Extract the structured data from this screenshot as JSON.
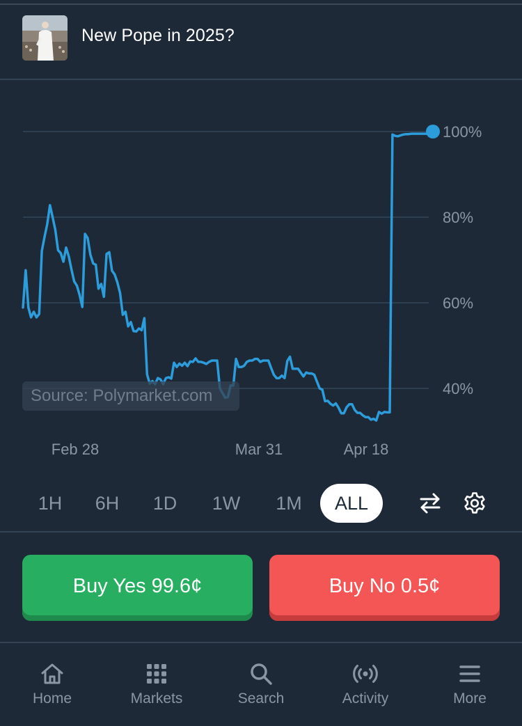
{
  "market": {
    "title": "New Pope in 2025?",
    "thumbnail": "pope-photo"
  },
  "chart_data": {
    "type": "line",
    "title": "",
    "xlabel": "",
    "ylabel": "",
    "ylim": [
      0,
      100
    ],
    "y_gridlines": [
      40,
      60,
      80,
      100
    ],
    "y_tick_labels": [
      "40%",
      "60%",
      "80%",
      "100%"
    ],
    "x_tick_labels": [
      "Feb 28",
      "Mar 31",
      "Apr 18"
    ],
    "grid": true,
    "color": "#2d9cdb",
    "watermark": "Source: Polymarket.com",
    "series": [
      {
        "values": [
          58.9,
          67.6,
          58.9,
          56.6,
          57.9,
          56.6,
          57.4,
          72.1,
          75.4,
          78.4,
          82.8,
          80.0,
          77.0,
          72.3,
          71.6,
          69.6,
          72.9,
          70.8,
          67.7,
          65.0,
          64.0,
          61.8,
          59.0,
          76.1,
          75.1,
          71.2,
          69.2,
          68.9,
          63.3,
          64.4,
          61.4,
          71.4,
          71.8,
          67.5,
          66.6,
          64.8,
          62.3,
          57.2,
          57.9,
          54.5,
          55.5,
          53.4,
          53.3,
          54.0,
          53.6,
          56.4,
          43.3,
          41.1,
          41.7,
          41.0,
          42.4,
          42.1,
          41.0,
          42.4,
          42.6,
          42.3,
          46.0,
          45.0,
          45.8,
          45.3,
          46.0,
          45.2,
          46.3,
          46.2,
          47.0,
          46.2,
          46.2,
          46.0,
          45.7,
          46.2,
          46.5,
          46.5,
          46.5,
          40.0,
          38.9,
          37.8,
          38.0,
          40.7,
          40.7,
          46.9,
          45.0,
          45.0,
          45.3,
          46.2,
          46.5,
          46.5,
          46.9,
          46.9,
          46.2,
          46.5,
          46.5,
          46.5,
          44.8,
          43.2,
          42.4,
          42.4,
          43.0,
          42.4,
          46.4,
          47.4,
          44.6,
          44.6,
          44.6,
          43.7,
          42.8,
          43.7,
          43.5,
          43.5,
          43.2,
          41.6,
          40.0,
          39.7,
          37.0,
          37.1,
          36.4,
          36.0,
          36.5,
          35.5,
          34.2,
          34.2,
          35.6,
          36.3,
          36.3,
          35.0,
          34.3,
          34.3,
          33.7,
          33.3,
          33.3,
          32.7,
          32.9,
          32.5,
          34.5,
          34.1,
          34.5,
          34.4,
          34.4,
          99.3,
          99.0,
          98.9,
          99.1,
          99.3,
          99.4,
          99.4,
          99.5,
          99.5,
          99.5,
          99.5,
          99.5,
          99.5,
          99.5,
          99.8,
          100.0
        ]
      }
    ]
  },
  "timeframes": {
    "options": [
      "1H",
      "6H",
      "1D",
      "1W",
      "1M",
      "ALL"
    ],
    "selected": "ALL"
  },
  "controls": {
    "swap_icon": "swap-arrows-icon",
    "settings_icon": "gear-icon"
  },
  "actions": {
    "buy_yes_label": "Buy Yes 99.6¢",
    "buy_no_label": "Buy No 0.5¢",
    "yes_color": "#27ae60",
    "no_color": "#f45555"
  },
  "nav": {
    "items": [
      {
        "label": "Home",
        "icon": "home-icon"
      },
      {
        "label": "Markets",
        "icon": "grid-icon"
      },
      {
        "label": "Search",
        "icon": "search-icon"
      },
      {
        "label": "Activity",
        "icon": "broadcast-icon"
      },
      {
        "label": "More",
        "icon": "menu-icon"
      }
    ]
  }
}
